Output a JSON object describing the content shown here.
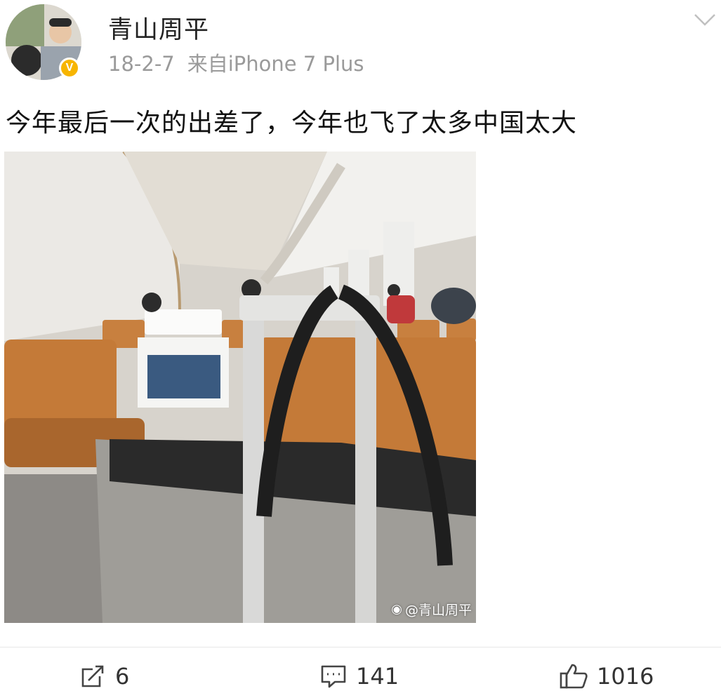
{
  "post": {
    "username": "青山周平",
    "date": "18-2-7",
    "source": "来自iPhone 7 Plus",
    "verified_badge": "V",
    "text": "今年最后一次的出差了，今年也飞了太多中国太大",
    "image_watermark": "@青山周平"
  },
  "actions": {
    "repost_count": "6",
    "comment_count": "141",
    "like_count": "1016"
  },
  "colors": {
    "meta_text": "#9a9a9a",
    "badge": "#f7b500",
    "seat_orange": "#c8803f"
  },
  "icons": [
    "chevron-down-icon",
    "verified-icon",
    "repost-icon",
    "comment-icon",
    "like-icon",
    "weibo-icon"
  ]
}
